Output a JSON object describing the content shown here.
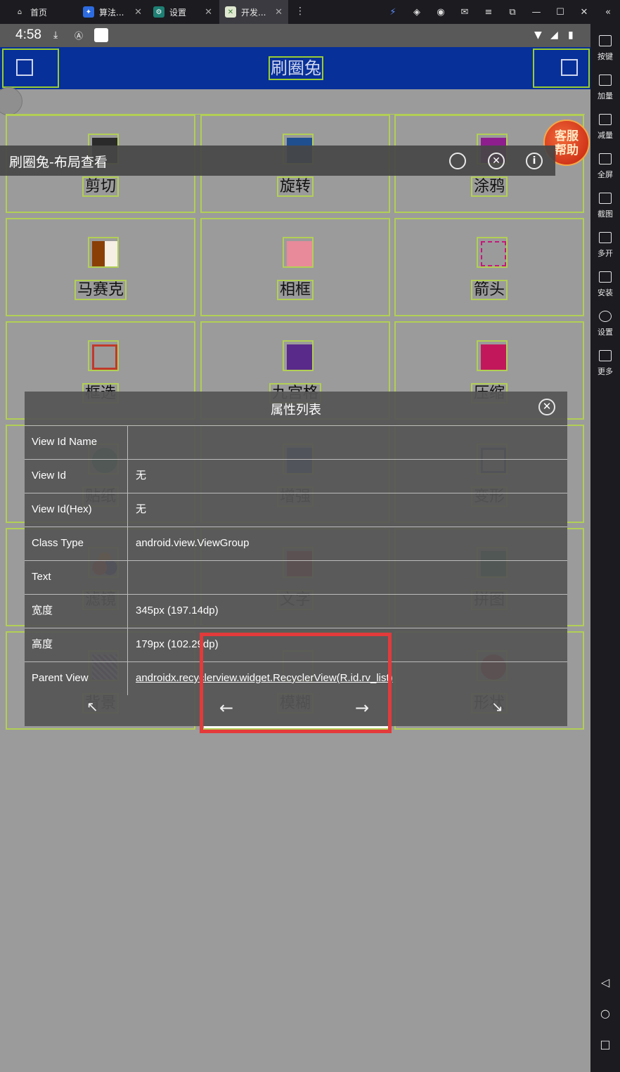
{
  "tabs": [
    {
      "label": "首页",
      "icon": "home-icon"
    },
    {
      "label": "算法...",
      "icon": "app-icon"
    },
    {
      "label": "设置",
      "icon": "settings-icon"
    },
    {
      "label": "开发...",
      "icon": "dev-app-icon"
    }
  ],
  "sidebar": {
    "items": [
      {
        "label": "按键",
        "icon": "keyboard-icon"
      },
      {
        "label": "加量",
        "icon": "volume-up-icon"
      },
      {
        "label": "减量",
        "icon": "volume-down-icon"
      },
      {
        "label": "全屏",
        "icon": "fullscreen-icon"
      },
      {
        "label": "截图",
        "icon": "scissors-icon"
      },
      {
        "label": "多开",
        "icon": "multi-instance-icon"
      },
      {
        "label": "安装",
        "icon": "apk-install-icon"
      },
      {
        "label": "设置",
        "icon": "gear-icon"
      },
      {
        "label": "更多",
        "icon": "more-icon"
      }
    ]
  },
  "status_bar": {
    "time": "4:58"
  },
  "app": {
    "title": "刷圈兔"
  },
  "help_badge": {
    "line1": "客服",
    "line2": "帮助"
  },
  "grid": [
    {
      "label": "剪切",
      "color": "#2a2a2a"
    },
    {
      "label": "旋转",
      "color": "#1f4f8f"
    },
    {
      "label": "涂鸦",
      "color": "#8e1e8e"
    },
    {
      "label": "马赛克",
      "color": "#b8652a"
    },
    {
      "label": "相框",
      "color": "#e27b8e"
    },
    {
      "label": "箭头",
      "color": "#c21a7a"
    },
    {
      "label": "框选",
      "color": "#c0392b"
    },
    {
      "label": "九宫格",
      "color": "#5a2a8a"
    },
    {
      "label": "压缩",
      "color": "#c2185b"
    },
    {
      "label": "贴纸",
      "color": "#1f7f5f"
    },
    {
      "label": "增强",
      "color": "#1f4f9f"
    },
    {
      "label": "变形",
      "color": "#2a3f7f"
    },
    {
      "label": "滤镜",
      "color": "#c0392b"
    },
    {
      "label": "文字",
      "color": "#b8262e"
    },
    {
      "label": "拼图",
      "color": "#1f6f4f"
    },
    {
      "label": "背景",
      "color": "#6a4a8a"
    },
    {
      "label": "模糊",
      "color": "#c58f9a"
    },
    {
      "label": "形状",
      "color": "#a51d2d"
    }
  ],
  "viewer": {
    "title": "刷圈兔-布局查看"
  },
  "properties": {
    "title": "属性列表",
    "rows": [
      {
        "key": "View Id Name",
        "value": ""
      },
      {
        "key": "View Id",
        "value": "无"
      },
      {
        "key": "View Id(Hex)",
        "value": "无"
      },
      {
        "key": "Class Type",
        "value": "android.view.ViewGroup"
      },
      {
        "key": "Text",
        "value": ""
      },
      {
        "key": "宽度",
        "value": "345px (197.14dp)"
      },
      {
        "key": "高度",
        "value": "179px (102.29dp)"
      },
      {
        "key": "Parent View",
        "value": "androidx.recyclerview.widget.RecyclerView(R.id.rv_list)"
      }
    ],
    "arrows": {
      "nw": "↖",
      "left": "←",
      "right": "→",
      "se": "↘"
    }
  }
}
